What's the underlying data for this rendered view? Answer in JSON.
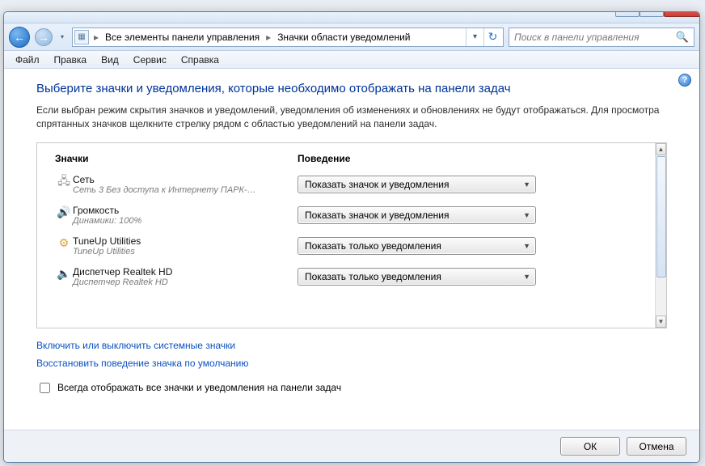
{
  "nav": {
    "breadcrumb_icon": "control-panel",
    "crumb1": "Все элементы панели управления",
    "crumb2": "Значки области уведомлений"
  },
  "search": {
    "placeholder": "Поиск в панели управления"
  },
  "menu": {
    "file": "Файл",
    "edit": "Правка",
    "view": "Вид",
    "service": "Сервис",
    "help": "Справка"
  },
  "page": {
    "title": "Выберите значки и уведомления, которые необходимо отображать на панели задач",
    "desc": "Если выбран режим скрытия значков и уведомлений, уведомления об изменениях и обновлениях не будут отображаться. Для просмотра спрятанных значков щелкните стрелку рядом с областью уведомлений на панели задач."
  },
  "columns": {
    "icons": "Значки",
    "behavior": "Поведение"
  },
  "rows": [
    {
      "icon": "network-icon",
      "name": "Сеть",
      "sub": "Сеть 3 Без доступа к Интернету ПАРК-…",
      "value": "Показать значок и уведомления"
    },
    {
      "icon": "volume-icon",
      "name": "Громкость",
      "sub": "Динамики: 100%",
      "value": "Показать значок и уведомления"
    },
    {
      "icon": "tuneup-icon",
      "name": "TuneUp Utilities",
      "sub": "TuneUp Utilities",
      "value": "Показать только уведомления"
    },
    {
      "icon": "realtek-icon",
      "name": "Диспетчер Realtek HD",
      "sub": "Диспетчер Realtek HD",
      "value": "Показать только уведомления"
    }
  ],
  "links": {
    "system_icons": "Включить или выключить системные значки",
    "restore_defaults": "Восстановить поведение значка по умолчанию"
  },
  "checkbox": {
    "label": "Всегда отображать все значки и уведомления на панели задач"
  },
  "buttons": {
    "ok": "ОК",
    "cancel": "Отмена"
  }
}
